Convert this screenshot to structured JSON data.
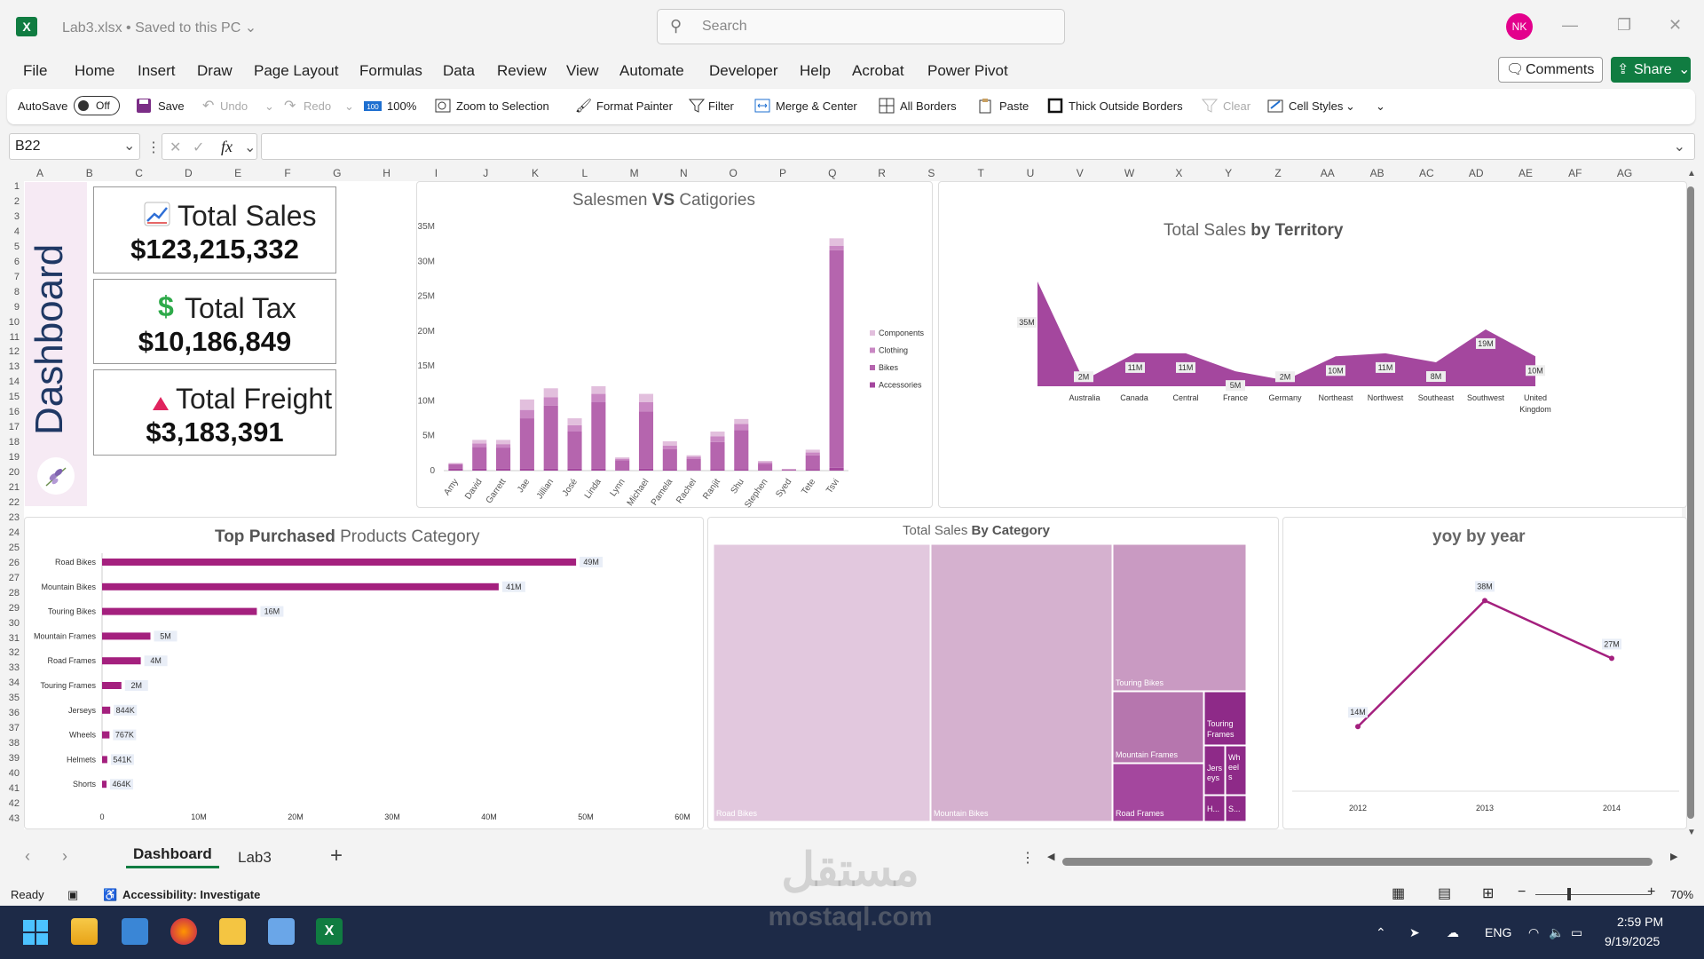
{
  "titlebar": {
    "app_icon": "X",
    "doc_title": "Lab3.xlsx • Saved to this PC",
    "search_placeholder": "Search",
    "user_initials": "NK"
  },
  "menu": {
    "items": [
      "File",
      "Home",
      "Insert",
      "Draw",
      "Page Layout",
      "Formulas",
      "Data",
      "Review",
      "View",
      "Automate",
      "Developer",
      "Help",
      "Acrobat",
      "Power Pivot"
    ],
    "comments_label": "Comments",
    "share_label": "Share"
  },
  "ribbon": {
    "autosave_label": "AutoSave",
    "autosave_state": "Off",
    "save": "Save",
    "undo": "Undo",
    "redo": "Redo",
    "zoom_100": "100%",
    "zoom_selection": "Zoom to Selection",
    "format_painter": "Format Painter",
    "filter": "Filter",
    "merge_center": "Merge & Center",
    "all_borders": "All Borders",
    "paste": "Paste",
    "thick_borders": "Thick Outside Borders",
    "clear": "Clear",
    "cell_styles": "Cell Styles"
  },
  "formula_bar": {
    "name_box": "B22",
    "fx": "fx",
    "formula": ""
  },
  "columns": [
    "A",
    "B",
    "C",
    "D",
    "E",
    "F",
    "G",
    "H",
    "I",
    "J",
    "K",
    "L",
    "M",
    "N",
    "O",
    "P",
    "Q",
    "R",
    "S",
    "T",
    "U",
    "V",
    "W",
    "X",
    "Y",
    "Z",
    "AA",
    "AB",
    "AC",
    "AD",
    "AE",
    "AF",
    "AG"
  ],
  "rows": [
    "1",
    "2",
    "3",
    "4",
    "5",
    "6",
    "7",
    "8",
    "9",
    "10",
    "11",
    "12",
    "13",
    "14",
    "15",
    "16",
    "17",
    "18",
    "19",
    "20",
    "21",
    "22",
    "23",
    "24",
    "25",
    "26",
    "27",
    "28",
    "29",
    "30",
    "31",
    "32",
    "33",
    "34",
    "35",
    "36",
    "37",
    "38",
    "39",
    "40",
    "41",
    "42",
    "43"
  ],
  "dashboard": {
    "title": "Dashboard",
    "kpis": [
      {
        "icon": "chart-up-icon",
        "label": "Total Sales",
        "value": "$123,215,332"
      },
      {
        "icon": "dollar-icon",
        "label": "Total Tax",
        "value": "$10,186,849"
      },
      {
        "icon": "triangle-icon",
        "label": "Total Freight",
        "value": "$3,183,391"
      }
    ],
    "colors": {
      "accent": "#a4479e",
      "accent_dark": "#8e2a88",
      "side_panel": "#f6eaf4",
      "navy": "#1f3864"
    }
  },
  "chart_data": [
    {
      "type": "bar",
      "title_parts": [
        "Salesmen ",
        "VS",
        " Catigories"
      ],
      "stacked": true,
      "categories": [
        "Amy",
        "David",
        "Garrett",
        "Jae",
        "Jillian",
        "José",
        "Linda",
        "Lynn",
        "Michael",
        "Pamela",
        "Rachel",
        "Ranjit",
        "Shu",
        "Stephen",
        "Syed",
        "Tete",
        "Tsvi"
      ],
      "series": [
        {
          "name": "Accessories",
          "color": "#a4479e",
          "values": [
            0.3,
            0.3,
            0.3,
            0.3,
            0.3,
            0.3,
            0.3,
            0.1,
            0.3,
            0.2,
            0.1,
            0.2,
            0.2,
            0.1,
            0.0,
            0.2,
            0.4
          ]
        },
        {
          "name": "Bikes",
          "color": "#b565ae",
          "values": [
            0.6,
            3.1,
            3.0,
            7.2,
            9.0,
            5.3,
            9.5,
            1.4,
            8.2,
            2.9,
            1.6,
            3.9,
            5.6,
            0.9,
            0.2,
            2.0,
            31.2
          ]
        },
        {
          "name": "Clothing",
          "color": "#c987c3",
          "values": [
            0.1,
            0.5,
            0.5,
            1.2,
            1.2,
            0.9,
            1.2,
            0.2,
            1.3,
            0.5,
            0.3,
            0.8,
            0.9,
            0.2,
            0.0,
            0.4,
            0.6
          ]
        },
        {
          "name": "Components",
          "color": "#e2bfdd",
          "values": [
            0.1,
            0.5,
            0.6,
            1.5,
            1.3,
            1.0,
            1.1,
            0.2,
            1.2,
            0.6,
            0.2,
            0.7,
            0.7,
            0.2,
            0.0,
            0.4,
            1.1
          ]
        }
      ],
      "yticks": [
        "0",
        "5M",
        "10M",
        "15M",
        "20M",
        "25M",
        "30M",
        "35M"
      ],
      "ylim": [
        0,
        35
      ]
    },
    {
      "type": "area",
      "title_parts": [
        "Total Sales ",
        "by Territory"
      ],
      "categories": [
        "Australia",
        "Canada",
        "Central",
        "France",
        "Germany",
        "Northeast",
        "Northwest",
        "Southeast",
        "Southwest",
        "United Kingdom"
      ],
      "values": [
        35,
        2,
        11,
        11,
        5,
        2,
        10,
        11,
        8,
        19,
        10
      ],
      "point_labels": [
        "35M",
        "2M",
        "11M",
        "11M",
        "5M",
        "2M",
        "10M",
        "11M",
        "8M",
        "19M",
        "10M"
      ],
      "units": "M"
    },
    {
      "type": "bar",
      "orientation": "horizontal",
      "title_parts": [
        "Top  ",
        "Purchased",
        " Products Category"
      ],
      "categories": [
        "Road Bikes",
        "Mountain Bikes",
        "Touring Bikes",
        "Mountain Frames",
        "Road Frames",
        "Touring Frames",
        "Jerseys",
        "Wheels",
        "Helmets",
        "Shorts"
      ],
      "values": [
        49,
        41,
        16,
        5,
        4,
        2,
        0.844,
        0.767,
        0.541,
        0.464
      ],
      "value_labels": [
        "49M",
        "41M",
        "16M",
        "5M",
        "4M",
        "2M",
        "844K",
        "767K",
        "541K",
        "464K"
      ],
      "xticks": [
        "0",
        "10M",
        "20M",
        "30M",
        "40M",
        "50M",
        "60M"
      ],
      "xlim": [
        0,
        60
      ]
    },
    {
      "type": "treemap",
      "title_parts": [
        "Total Sales ",
        "By Category"
      ],
      "cells": [
        {
          "label": "Road Bikes",
          "color": "#e2c8de"
        },
        {
          "label": "Mountain Bikes",
          "color": "#d5b1cf"
        },
        {
          "label": "Touring Bikes",
          "color": "#c99ac2"
        },
        {
          "label": "Mountain Frames",
          "color": "#b676ae"
        },
        {
          "label": "Road Frames",
          "color": "#a4479e"
        },
        {
          "label": "Touring Frames",
          "color": "#8e2a88"
        },
        {
          "label": "Jers eys",
          "color": "#8e2a88"
        },
        {
          "label": "Wh eel s",
          "color": "#8e2a88"
        },
        {
          "label": "H...",
          "color": "#8e2a88"
        },
        {
          "label": "S...",
          "color": "#8e2a88"
        }
      ]
    },
    {
      "type": "line",
      "title_parts": [
        "yoy by year"
      ],
      "categories": [
        "2012",
        "2013",
        "2014"
      ],
      "values": [
        14,
        38,
        27
      ],
      "point_labels": [
        "14M",
        "38M",
        "27M"
      ],
      "ylim": [
        0,
        45
      ]
    }
  ],
  "sheet_tabs": {
    "active": "Dashboard",
    "other": "Lab3"
  },
  "status": {
    "ready": "Ready",
    "accessibility": "Accessibility: Investigate",
    "zoom": "70%"
  },
  "taskbar": {
    "lang": "ENG",
    "time": "2:59 PM",
    "date": "9/19/2025"
  },
  "watermark": {
    "arabic": "مستقل",
    "latin": "mostaql.com"
  }
}
